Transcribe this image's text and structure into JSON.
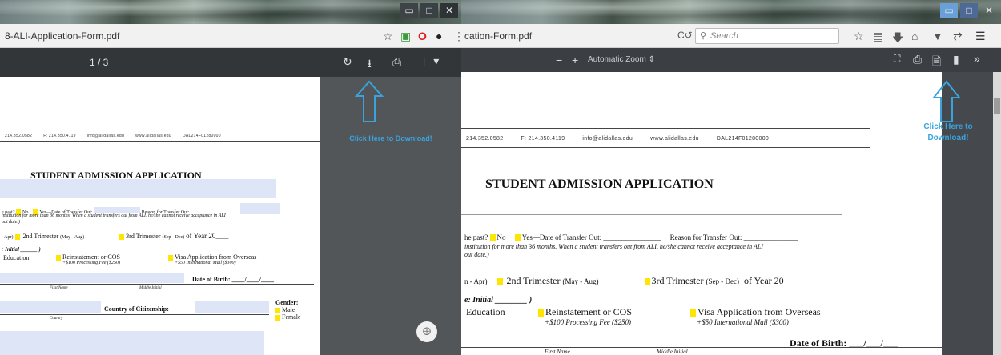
{
  "left": {
    "url": "8-ALI-Application-Form.pdf",
    "page_counter": "1 / 3",
    "annotation": "Click Here to Download!",
    "contact": [
      "214.352.0582",
      "F: 214.350.4119",
      "info@alidallas.edu",
      "www.alidallas.edu",
      "DAL214F01280000"
    ],
    "title": "STUDENT ADMISSION APPLICATION",
    "rows": {
      "r1a": "e past?",
      "r1b": "No",
      "r1c": "Yes—Date of Transfer Out:",
      "r1d": "Reason for Transfer Out:",
      "r2": "institution for more than 36 months.  When a student transfers out from ALI, he/she cannot receive acceptance in ALI",
      "r3": "out date.)",
      "r4a": "- Apr)",
      "r4b": "2nd Trimester",
      "r4c": "(May - Aug)",
      "r4d": "3rd Trimester",
      "r4e": "(Sep - Dec)",
      "r4f": "of Year 20",
      "r5": "Initial",
      "r6a": "Education",
      "r6b": "Reinstatement or COS",
      "r6c": "+$100 Processing Fee ($250)",
      "r6d": "Visa Application from Overseas",
      "r6e": "+$50 International Mail ($300)",
      "r7": "Date of Birth:",
      "r8a": "First Name",
      "r8b": "Middle Initial",
      "r9": "Country of Citizenship:",
      "r10": "Country",
      "gender": "Gender:",
      "male": "Male",
      "female": "Female"
    }
  },
  "right": {
    "url": "cation-Form.pdf",
    "search_placeholder": "Search",
    "zoom": "Automatic Zoom",
    "annotation": "Click Here to Download!",
    "contact": [
      "214.352.0582",
      "F: 214.350.4119",
      "info@alidallas.edu",
      "www.alidallas.edu",
      "DAL214F01280000"
    ],
    "title": "STUDENT ADMISSION APPLICATION",
    "rows": {
      "r1a": "he past?",
      "r1b": "No",
      "r1c": "Yes—Date of Transfer Out:",
      "r1d": "Reason for Transfer Out:",
      "r2": "institution for more than 36 months.  When a student transfers out from ALI, he/she cannot receive acceptance in ALI",
      "r3": "out date.)",
      "r4a": "n - Apr)",
      "r4b": "2nd Trimester",
      "r4c": "(May - Aug)",
      "r4d": "3rd Trimester",
      "r4e": "(Sep - Dec)",
      "r4f": "of Year 20",
      "r5": "Initial",
      "r6a": "Education",
      "r6b": "Reinstatement or COS",
      "r6c": "+$100 Processing Fee ($250)",
      "r6d": "Visa Application from Overseas",
      "r6e": "+$50 International Mail ($300)",
      "r7": "Date of Birth:",
      "r8a": "First Name",
      "r8b": "Middle Initial"
    }
  },
  "colors": {
    "annotation": "#3aa3de",
    "highlight": "#ffe600",
    "field": "#dde5f7"
  }
}
